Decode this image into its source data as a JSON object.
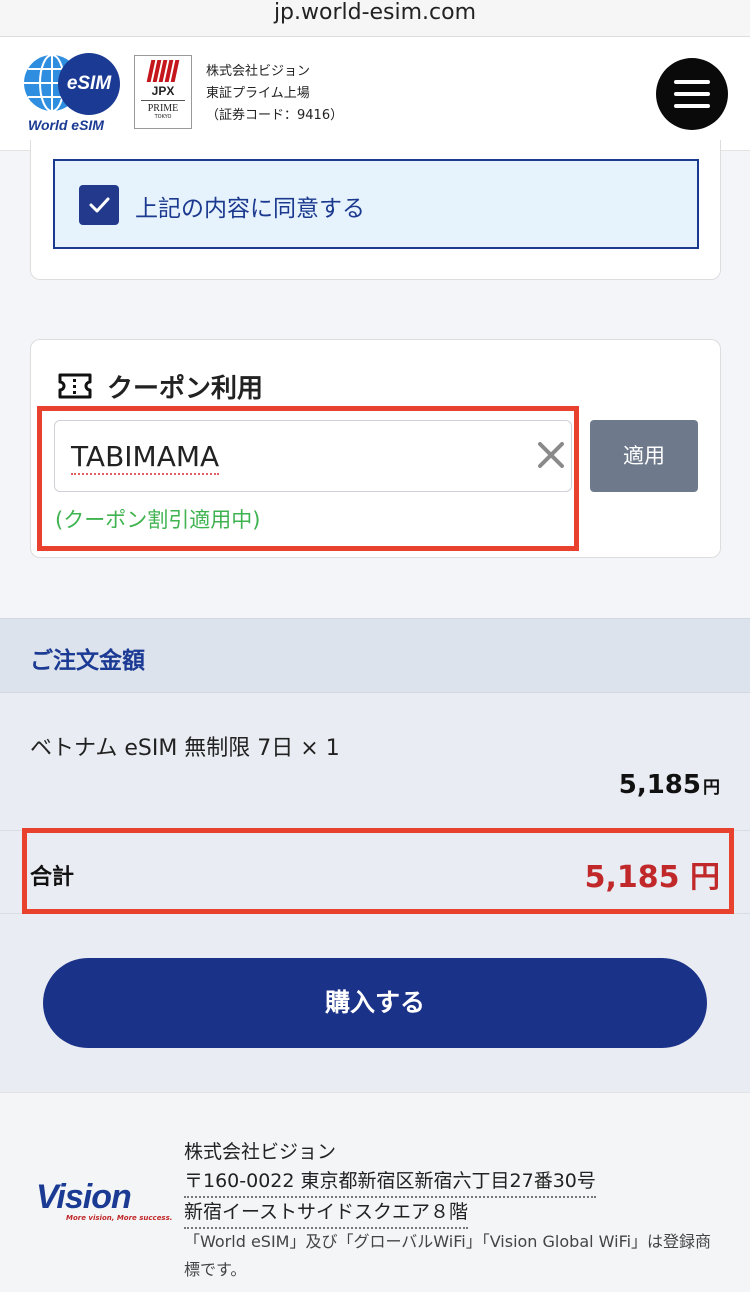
{
  "browser": {
    "url": "jp.world-esim.com"
  },
  "header": {
    "logo_text": "World eSIM",
    "logo_badge": "eSIM",
    "jpx_label": "JPX",
    "jpx_prime": "PRIME",
    "jpx_tokyo": "TOKYO",
    "company_line1": "株式会社ビジョン",
    "company_line2": "東証プライム上場",
    "company_line3": "（証券コード：9416）"
  },
  "agreement": {
    "label": "上記の内容に同意する",
    "checked": true
  },
  "coupon": {
    "title": "クーポン利用",
    "input_value": "TABIMAMA",
    "apply_label": "適用",
    "status": "(クーポン割引適用中)"
  },
  "order": {
    "title": "ご注文金額",
    "item_name": "ベトナム eSIM 無制限 7日 × 1",
    "item_price": "5,185",
    "item_currency": "円",
    "total_label": "合計",
    "total_price": "5,185 円",
    "buy_label": "購入する"
  },
  "footer": {
    "logo_text": "Vision",
    "logo_tagline": "More vision, More success.",
    "company": "株式会社ビジョン",
    "address_line1": "〒160-0022 東京都新宿区新宿六丁目27番30号",
    "address_line2": "新宿イーストサイドスクエア８階",
    "trademark_note": "「World eSIM」及び「グローバルWiFi」「Vision Global WiFi」は登録商標です。"
  },
  "colors": {
    "brand_navy": "#1b3289",
    "highlight_red": "#e8412e",
    "total_red": "#c0282a",
    "coupon_green": "#3fb34f",
    "agree_bg": "#e6f2fc"
  },
  "icons": [
    "globe-icon",
    "menu-icon",
    "checkbox-check-icon",
    "ticket-icon",
    "clear-icon"
  ]
}
